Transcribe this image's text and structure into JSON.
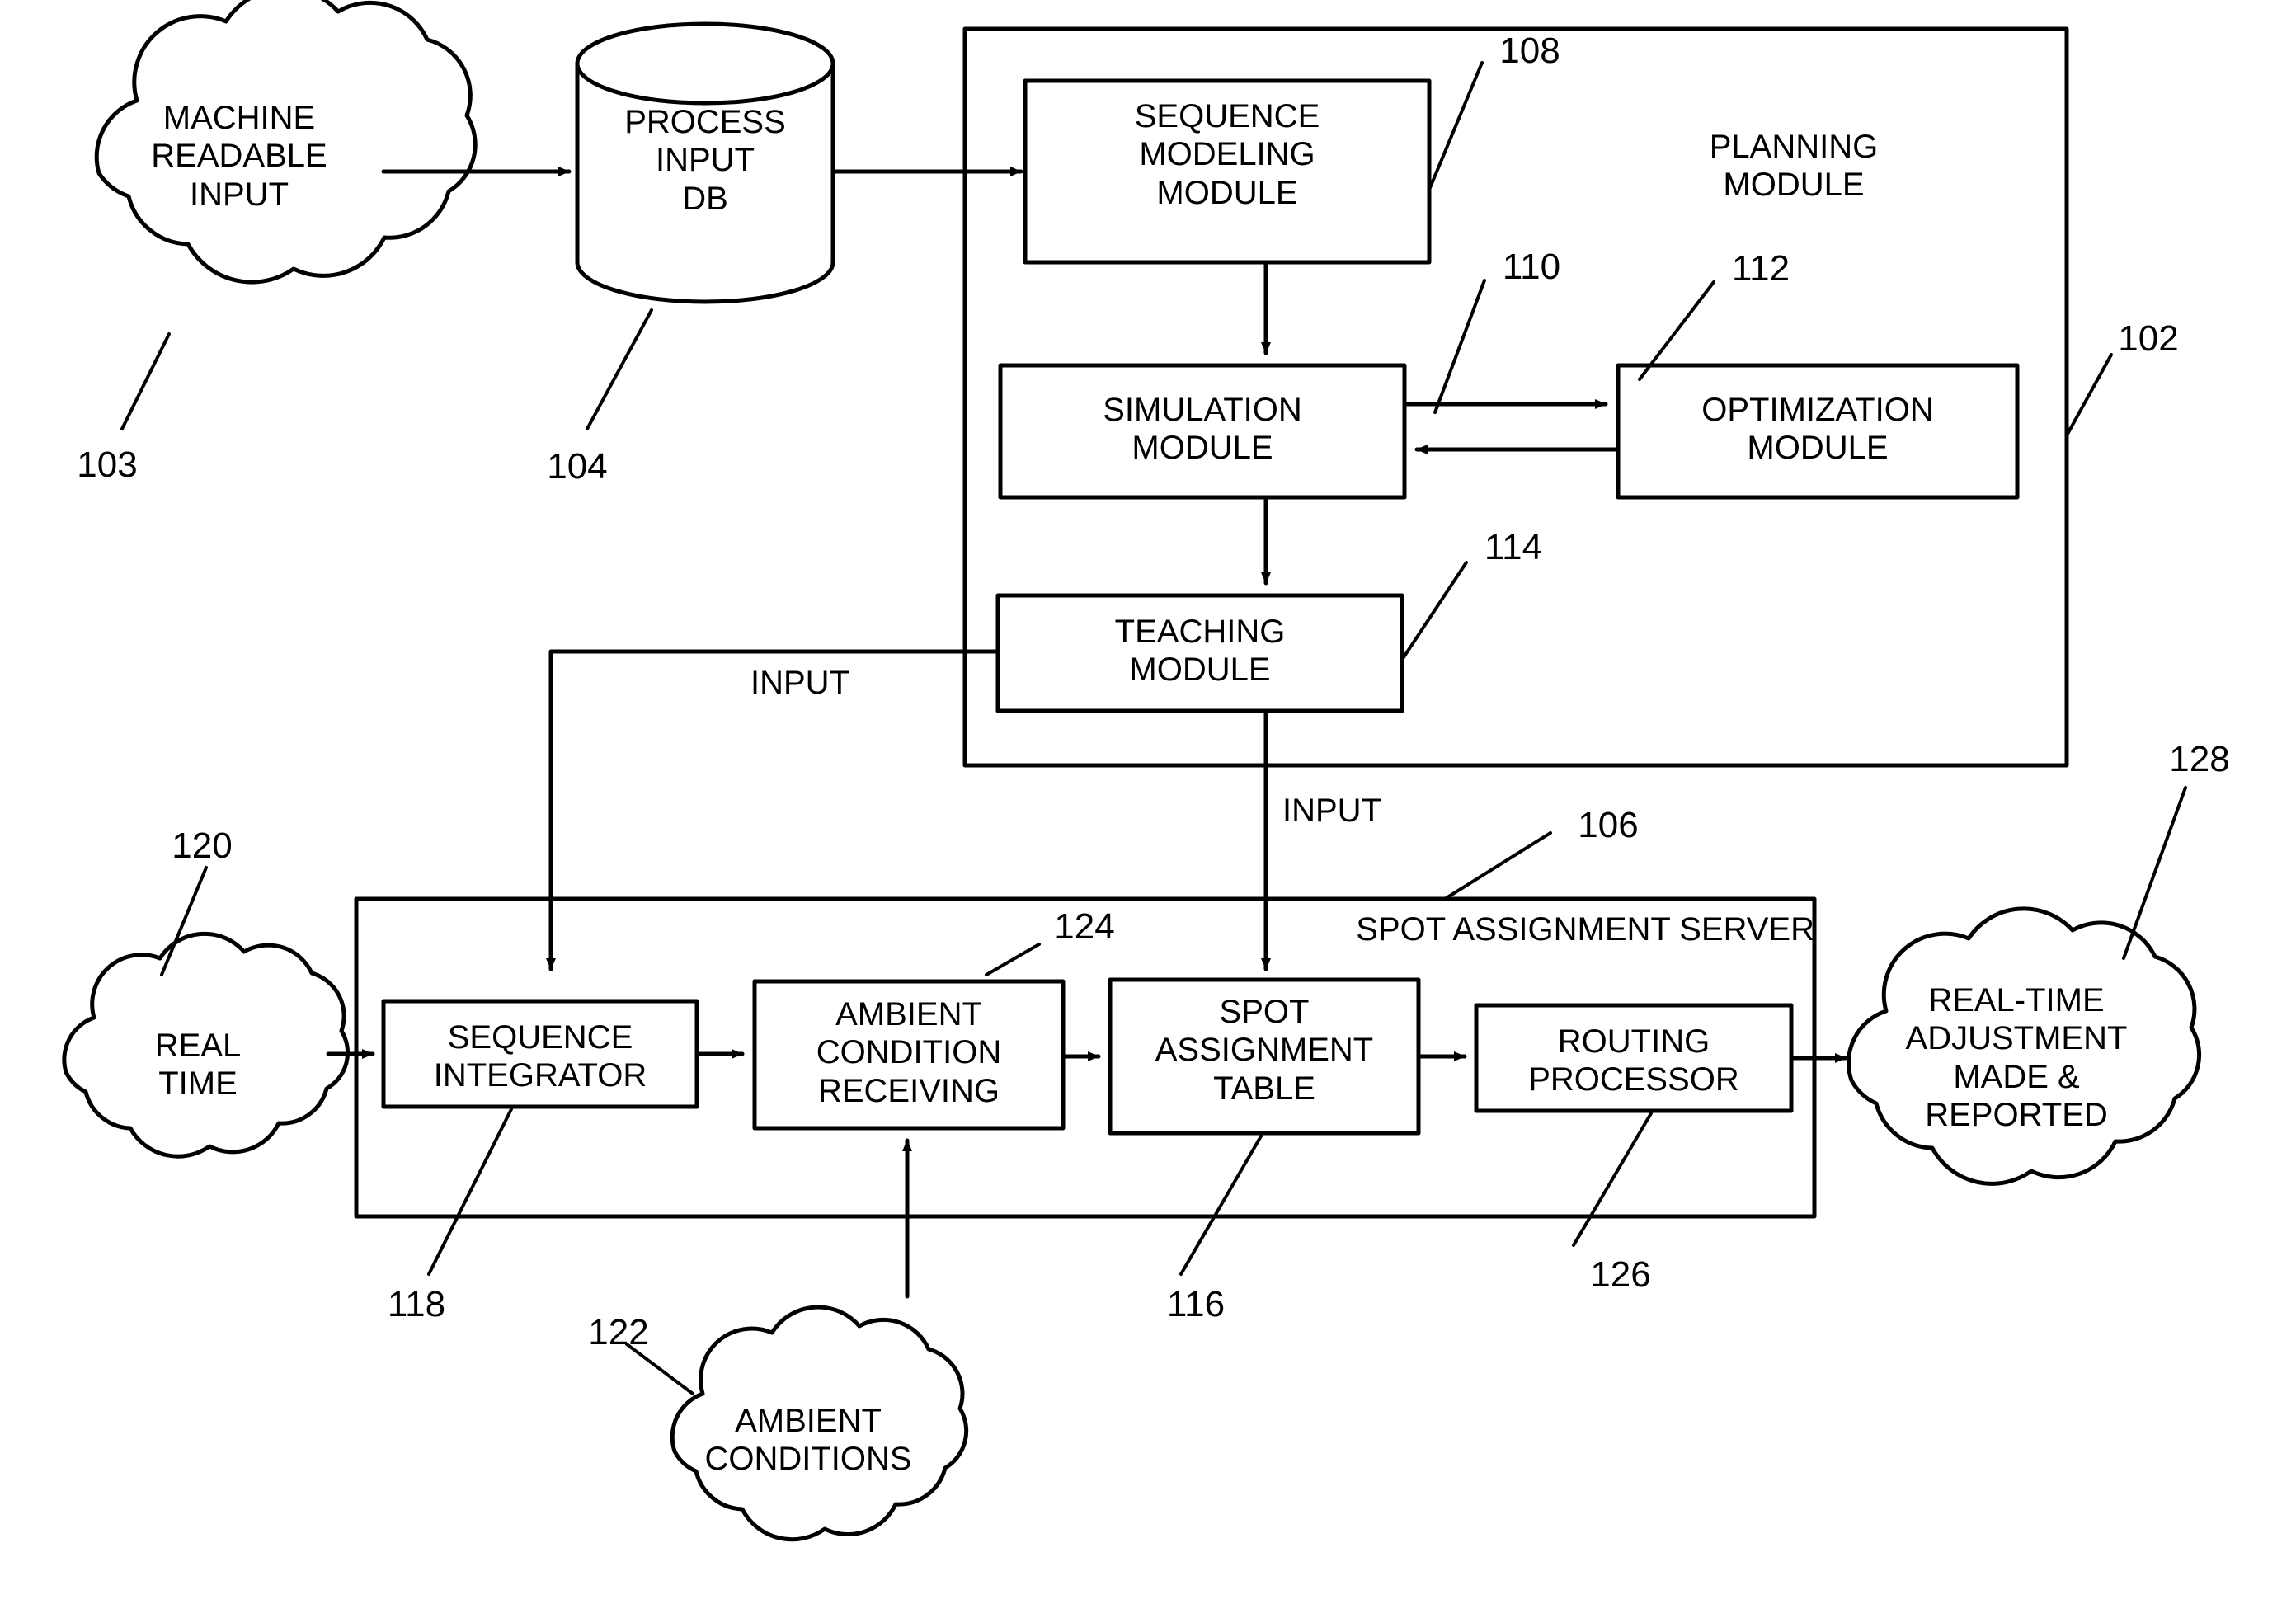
{
  "figure": {
    "type": "patent-block-diagram",
    "background": "#ffffff",
    "stroke": "#000000"
  },
  "clouds": [
    {
      "id": "machine-readable-input",
      "label": "MACHINE\nREADABLE\nINPUT",
      "ref": "103"
    },
    {
      "id": "real-time",
      "label": "REAL\nTIME",
      "ref": "120"
    },
    {
      "id": "ambient-conditions",
      "label": "AMBIENT\nCONDITIONS",
      "ref": "122"
    },
    {
      "id": "real-time-adjustment",
      "label": "REAL-TIME\nADJUSTMENT\nMADE &\nREPORTED",
      "ref": "128"
    }
  ],
  "database": {
    "id": "process-input-db",
    "label": "PROCESS\nINPUT\nDB",
    "ref": "104"
  },
  "planning_module": {
    "title": "PLANNING\nMODULE",
    "ref": "102",
    "boxes": [
      {
        "id": "sequence-modeling-module",
        "label": "SEQUENCE\nMODELING\nMODULE",
        "ref": "108"
      },
      {
        "id": "simulation-module",
        "label": "SIMULATION\nMODULE",
        "ref": "110"
      },
      {
        "id": "optimization-module",
        "label": "OPTIMIZATION\nMODULE",
        "ref": "112"
      },
      {
        "id": "teaching-module",
        "label": "TEACHING\nMODULE",
        "ref": "114"
      }
    ]
  },
  "spot_assignment_server": {
    "title": "SPOT ASSIGNMENT SERVER",
    "ref": "106",
    "boxes": [
      {
        "id": "sequence-integrator",
        "label": "SEQUENCE\nINTEGRATOR",
        "ref": "118"
      },
      {
        "id": "ambient-condition-receiving",
        "label": "AMBIENT\nCONDITION\nRECEIVING",
        "ref": "124"
      },
      {
        "id": "spot-assignment-table",
        "label": "SPOT\nASSIGNMENT\nTABLE",
        "ref": "116"
      },
      {
        "id": "routing-processor",
        "label": "ROUTING\nPROCESSOR",
        "ref": "126"
      }
    ]
  },
  "flow_labels": [
    {
      "id": "input-teaching-feedback",
      "label": "INPUT"
    },
    {
      "id": "input-to-server",
      "label": "INPUT"
    }
  ]
}
